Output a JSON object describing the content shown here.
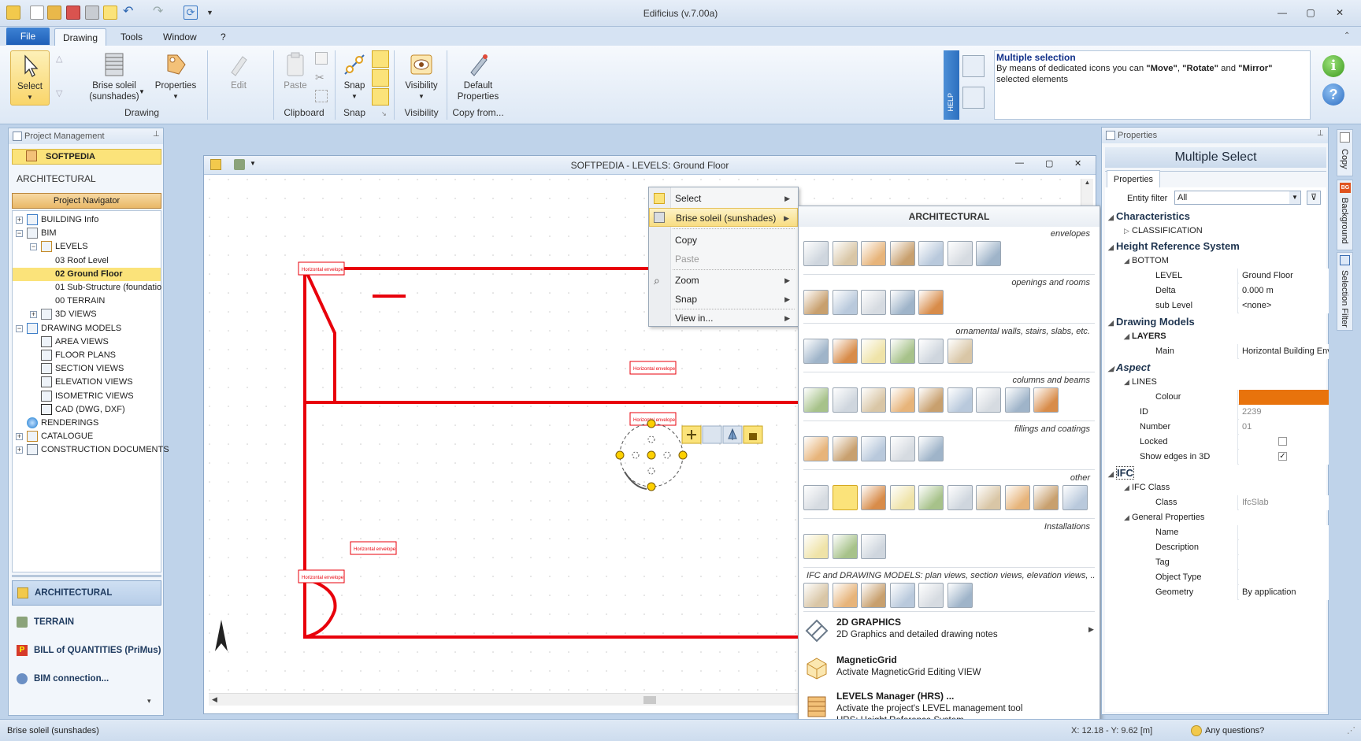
{
  "app": {
    "title": "Edificius (v.7.00a)"
  },
  "ribbon_tabs": [
    "File",
    "Drawing",
    "Tools",
    "Window",
    "?"
  ],
  "ribbon": {
    "select": "Select",
    "brise_line1": "Brise soleil",
    "brise_line2": "(sunshades)",
    "properties": "Properties",
    "group_drawing": "Drawing",
    "edit": "Edit",
    "paste": "Paste",
    "group_clipboard": "Clipboard",
    "snap": "Snap",
    "group_snap": "Snap",
    "visibility": "Visibility",
    "group_visibility": "Visibility",
    "default_line1": "Default",
    "default_line2": "Properties",
    "group_copyfrom": "Copy from...",
    "help_tab": "HELP"
  },
  "help": {
    "title": "Multiple selection",
    "text_prefix": "By means of dedicated icons you can ",
    "move": "\"Move\"",
    "comma": ", ",
    "rotate": "\"Rotate\"",
    "and": " and ",
    "mirror": "\"Mirror\"",
    "text_suffix": " selected elements"
  },
  "project_panel": {
    "header": "Project Management",
    "project_name": "SOFTPEDIA",
    "section": "ARCHITECTURAL",
    "navigator_button": "Project Navigator",
    "tree": [
      {
        "label": "BUILDING Info",
        "exp": "+"
      },
      {
        "label": "BIM",
        "exp": "−"
      },
      {
        "label": "LEVELS",
        "exp": "−"
      },
      {
        "label": "03 Roof Level",
        "exp": ""
      },
      {
        "label": "02 Ground Floor",
        "exp": ""
      },
      {
        "label": "01 Sub-Structure (foundatio",
        "exp": ""
      },
      {
        "label": "00 TERRAIN",
        "exp": ""
      },
      {
        "label": "3D VIEWS",
        "exp": "+"
      },
      {
        "label": "DRAWING MODELS",
        "exp": "−"
      },
      {
        "label": "AREA VIEWS",
        "exp": ""
      },
      {
        "label": "FLOOR PLANS",
        "exp": ""
      },
      {
        "label": "SECTION VIEWS",
        "exp": ""
      },
      {
        "label": "ELEVATION VIEWS",
        "exp": ""
      },
      {
        "label": "ISOMETRIC VIEWS",
        "exp": ""
      },
      {
        "label": "CAD (DWG, DXF)",
        "exp": ""
      },
      {
        "label": "RENDERINGS",
        "exp": ""
      },
      {
        "label": "CATALOGUE",
        "exp": "+"
      },
      {
        "label": "CONSTRUCTION DOCUMENTS",
        "exp": "+"
      }
    ],
    "bottom_nav": [
      "ARCHITECTURAL",
      "TERRAIN",
      "BILL of QUANTITIES (PriMus)",
      "BIM connection..."
    ]
  },
  "drawing": {
    "window_title": "SOFTPEDIA -  LEVELS: Ground Floor",
    "label": "Horizontal envelope"
  },
  "context_menu": {
    "items": [
      {
        "label": "Select",
        "arrow": "▶"
      },
      {
        "label": "Brise soleil (sunshades)",
        "arrow": "▶"
      },
      {
        "label": "Copy",
        "arrow": ""
      },
      {
        "label": "Paste",
        "arrow": ""
      },
      {
        "label": "Zoom",
        "arrow": "▶"
      },
      {
        "label": "Snap",
        "arrow": "▶"
      },
      {
        "label": "View in...",
        "arrow": "▶"
      }
    ]
  },
  "submenu": {
    "header": "ARCHITECTURAL",
    "sections": [
      "envelopes",
      "openings and rooms",
      "ornamental walls, stairs, slabs, etc.",
      "columns and beams",
      "fillings and coatings",
      "other",
      "Installations",
      "IFC and DRAWING MODELS: plan views, section views, elevation views, ..."
    ],
    "graphics_title": "2D GRAPHICS",
    "graphics_desc": "2D Graphics and detailed drawing notes",
    "magnetic_title": "MagneticGrid",
    "magnetic_desc": "Activate MagneticGrid Editing VIEW",
    "levels_title": "LEVELS Manager (HRS) ...",
    "levels_desc1": "Activate the project's LEVEL management tool",
    "levels_desc2": "HRS: Height Reference System"
  },
  "properties": {
    "header": "Properties",
    "title": "Multiple Select",
    "tab": "Properties",
    "entity_filter_label": "Entity filter",
    "entity_filter_value": "All",
    "cat_characteristics": "Characteristics",
    "classification": "CLASSIFICATION",
    "cat_hrs": "Height Reference System",
    "bottom": "BOTTOM",
    "level_k": "LEVEL",
    "level_v": "Ground Floor",
    "delta_k": "Delta",
    "delta_v": "0.000 m",
    "sublevel_k": "sub Level",
    "sublevel_v": "<none>",
    "cat_drawing_models": "Drawing Models",
    "layers": "LAYERS",
    "main_k": "Main",
    "main_v": "Horizontal Building Env",
    "cat_aspect": "Aspect",
    "lines": "LINES",
    "colour_k": "Colour",
    "colour_v": "#e8730c",
    "id_k": "ID",
    "id_v": "2239",
    "number_k": "Number",
    "number_v": "01",
    "locked_k": "Locked",
    "edges_k": "Show edges in 3D",
    "cat_ifc": "IFC",
    "ifc_class": "IFC Class",
    "class_k": "Class",
    "class_v": "IfcSlab",
    "general": "General Properties",
    "name_k": "Name",
    "desc_k": "Description",
    "tag_k": "Tag",
    "otype_k": "Object Type",
    "geom_k": "Geometry",
    "geom_v": "By application"
  },
  "sidebar_tabs": [
    "Copy",
    "Background",
    "Selection Filter"
  ],
  "status": {
    "left": "Brise soleil (sunshades)",
    "coords": "X: 12.18 - Y: 9.62 [m]",
    "help": "Any questions?"
  },
  "colors": {
    "accent": "#1f5fb8",
    "drawing_red": "#e8000b",
    "highlight": "#fbe37a"
  }
}
